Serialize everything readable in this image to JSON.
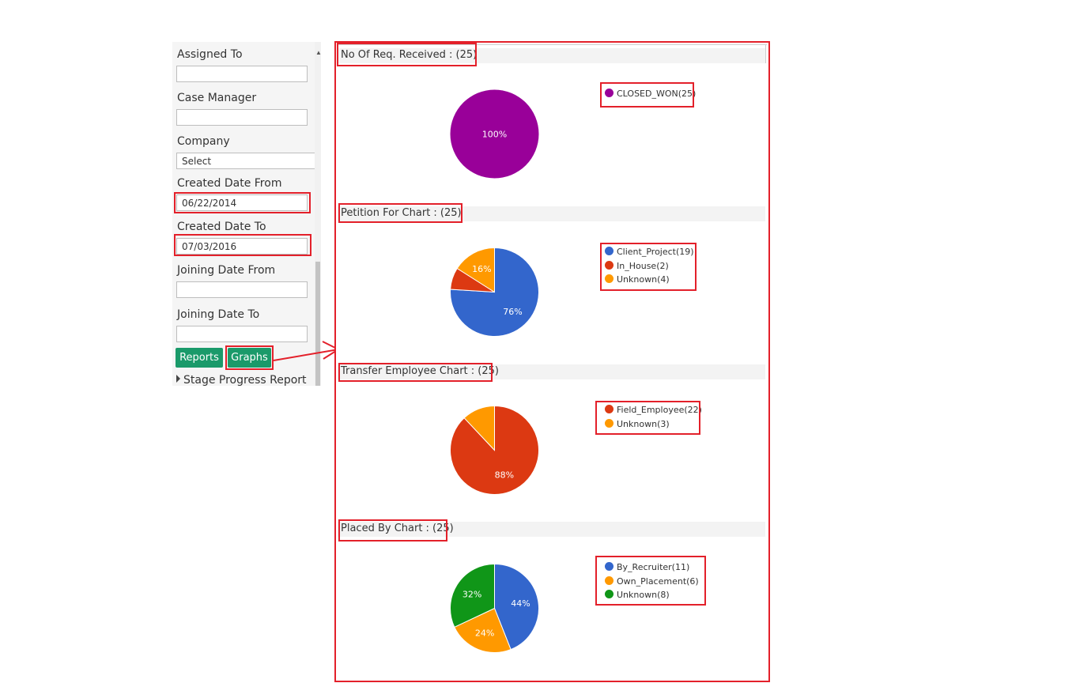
{
  "sidebar": {
    "assigned_to_label": "Assigned To",
    "assigned_to_value": "",
    "case_manager_label": "Case Manager",
    "case_manager_value": "",
    "company_label": "Company",
    "company_value": "Select",
    "created_from_label": "Created Date From",
    "created_from_value": "06/22/2014",
    "created_to_label": "Created Date To",
    "created_to_value": "07/03/2016",
    "joining_from_label": "Joining Date From",
    "joining_from_value": "",
    "joining_to_label": "Joining Date To",
    "joining_to_value": "",
    "reports_button": "Reports",
    "graphs_button": "Graphs",
    "stage_progress_label": "Stage Progress Report"
  },
  "colors": {
    "annotation": "#e3202a",
    "button": "#1a9a6a"
  },
  "chart_data": [
    {
      "type": "pie",
      "title": "No Of Req. Received : (25)",
      "series": [
        {
          "name": "CLOSED_WON",
          "value": 25,
          "color": "#990099",
          "label": "100%",
          "legend": "CLOSED_WON(25)"
        }
      ]
    },
    {
      "type": "pie",
      "title": "Petition For Chart : (25)",
      "series": [
        {
          "name": "Client_Project",
          "value": 19,
          "color": "#3366cc",
          "label": "76%",
          "legend": "Client_Project(19)"
        },
        {
          "name": "In_House",
          "value": 2,
          "color": "#dc3912",
          "label": "",
          "legend": "In_House(2)"
        },
        {
          "name": "Unknown",
          "value": 4,
          "color": "#ff9900",
          "label": "16%",
          "legend": "Unknown(4)"
        }
      ]
    },
    {
      "type": "pie",
      "title": "Transfer Employee Chart : (25)",
      "series": [
        {
          "name": "Field_Employee",
          "value": 22,
          "color": "#dc3912",
          "label": "88%",
          "legend": "Field_Employee(22)"
        },
        {
          "name": "Unknown",
          "value": 3,
          "color": "#ff9900",
          "label": "",
          "legend": "Unknown(3)"
        }
      ]
    },
    {
      "type": "pie",
      "title": "Placed By Chart : (25)",
      "series": [
        {
          "name": "By_Recruiter",
          "value": 11,
          "color": "#3366cc",
          "label": "44%",
          "legend": "By_Recruiter(11)"
        },
        {
          "name": "Own_Placement",
          "value": 6,
          "color": "#ff9900",
          "label": "24%",
          "legend": "Own_Placement(6)"
        },
        {
          "name": "Unknown",
          "value": 8,
          "color": "#109618",
          "label": "32%",
          "legend": "Unknown(8)"
        }
      ]
    }
  ]
}
